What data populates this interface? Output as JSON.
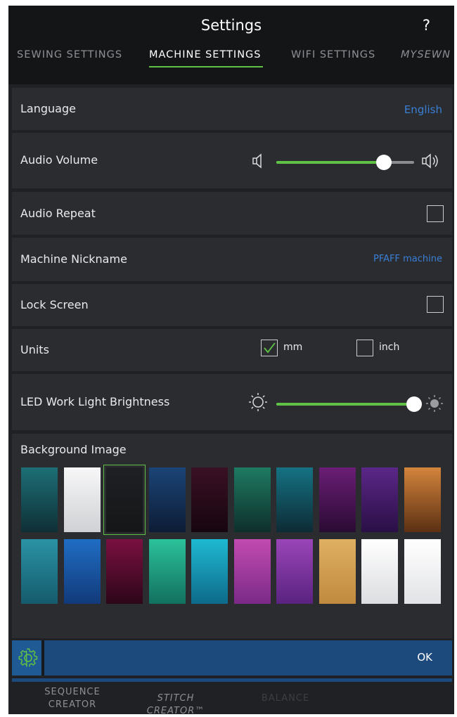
{
  "header": {
    "title": "Settings",
    "help": "?"
  },
  "tabs": [
    {
      "label": "SEWING SETTINGS",
      "active": false
    },
    {
      "label": "MACHINE SETTINGS",
      "active": true
    },
    {
      "label": "WIFI SETTINGS",
      "active": false
    },
    {
      "label": "MYSEWN",
      "active": false
    }
  ],
  "settings": {
    "language": {
      "label": "Language",
      "value": "English"
    },
    "audio_volume": {
      "label": "Audio Volume",
      "level": 0.78
    },
    "audio_repeat": {
      "label": "Audio Repeat",
      "checked": false
    },
    "nickname": {
      "label": "Machine Nickname",
      "value": "PFAFF machine"
    },
    "lock_screen": {
      "label": "Lock Screen",
      "checked": false
    },
    "units": {
      "label": "Units",
      "options": [
        {
          "label": "mm",
          "checked": true
        },
        {
          "label": "inch",
          "checked": false
        }
      ]
    },
    "led_brightness": {
      "label": "LED Work Light Brightness",
      "level": 1.0
    },
    "background": {
      "label": "Background Image",
      "selected_index": 2,
      "swatches": [
        [
          "#1d6f76",
          "#0f2f36"
        ],
        [
          "#f7f7f8",
          "#cfd1d4"
        ],
        [
          "#1e2023",
          "#151618"
        ],
        [
          "#1b4476",
          "#0d1c36"
        ],
        [
          "#3a1024",
          "#16060f"
        ],
        [
          "#1e7a62",
          "#0e2f2b"
        ],
        [
          "#157283",
          "#0d2b35"
        ],
        [
          "#6a1d75",
          "#2a0c33"
        ],
        [
          "#5b2788",
          "#2a0f45"
        ],
        [
          "#d4843c",
          "#5c3013"
        ],
        [
          "#2a93a5",
          "#155b6c"
        ],
        [
          "#1f6dc4",
          "#123a7a"
        ],
        [
          "#7a1040",
          "#2c0619"
        ],
        [
          "#2bc29a",
          "#12705f"
        ],
        [
          "#1fb9d2",
          "#0d6a8a"
        ],
        [
          "#c24bb0",
          "#7a2a88"
        ],
        [
          "#9a45b8",
          "#5a2380"
        ],
        [
          "#e0b062",
          "#c08a3e"
        ],
        [
          "#ffffff",
          "#dcdde0"
        ],
        [
          "#ffffff",
          "#e2e3e6"
        ]
      ]
    }
  },
  "bottom": {
    "ok": "OK"
  },
  "footer_tabs": [
    {
      "line1": "SEQUENCE",
      "line2": "CREATOR",
      "style": "normal"
    },
    {
      "line1": "STITCH CREATOR™",
      "style": "italic"
    },
    {
      "line1": "BALANCE",
      "style": "dim"
    }
  ],
  "colors": {
    "accent": "#5fc244",
    "link": "#3a7fd6",
    "background": "#1f2124",
    "row": "#2a2c30",
    "bar": "#1d4a7d"
  }
}
